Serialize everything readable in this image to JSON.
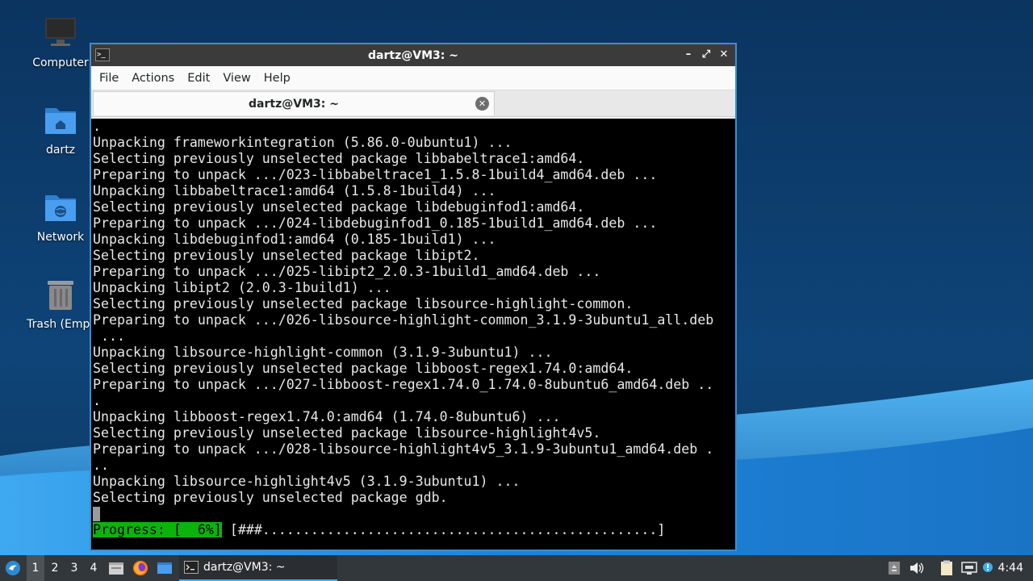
{
  "desktop": {
    "icons": [
      {
        "label": "Computer",
        "icon": "computer-icon"
      },
      {
        "label": "dartz",
        "icon": "home-folder-icon"
      },
      {
        "label": "Network",
        "icon": "network-folder-icon"
      },
      {
        "label": "Trash (Empt",
        "icon": "trash-icon"
      }
    ]
  },
  "window": {
    "title": "dartz@VM3: ~",
    "app_icon_glyph": ">_",
    "controls": {
      "minimize": "–",
      "maximize": "⤢",
      "close": "✕"
    },
    "menu": [
      "File",
      "Actions",
      "Edit",
      "View",
      "Help"
    ],
    "tab": {
      "label": "dartz@VM3: ~",
      "close_glyph": "✕"
    }
  },
  "terminal": {
    "lines": [
      ".",
      "Unpacking frameworkintegration (5.86.0-0ubuntu1) ...",
      "Selecting previously unselected package libbabeltrace1:amd64.",
      "Preparing to unpack .../023-libbabeltrace1_1.5.8-1build4_amd64.deb ...",
      "Unpacking libbabeltrace1:amd64 (1.5.8-1build4) ...",
      "Selecting previously unselected package libdebuginfod1:amd64.",
      "Preparing to unpack .../024-libdebuginfod1_0.185-1build1_amd64.deb ...",
      "Unpacking libdebuginfod1:amd64 (0.185-1build1) ...",
      "Selecting previously unselected package libipt2.",
      "Preparing to unpack .../025-libipt2_2.0.3-1build1_amd64.deb ...",
      "Unpacking libipt2 (2.0.3-1build1) ...",
      "Selecting previously unselected package libsource-highlight-common.",
      "Preparing to unpack .../026-libsource-highlight-common_3.1.9-3ubuntu1_all.deb",
      " ...",
      "Unpacking libsource-highlight-common (3.1.9-3ubuntu1) ...",
      "Selecting previously unselected package libboost-regex1.74.0:amd64.",
      "Preparing to unpack .../027-libboost-regex1.74.0_1.74.0-8ubuntu6_amd64.deb ..",
      ".",
      "Unpacking libboost-regex1.74.0:amd64 (1.74.0-8ubuntu6) ...",
      "Selecting previously unselected package libsource-highlight4v5.",
      "Preparing to unpack .../028-libsource-highlight4v5_3.1.9-3ubuntu1_amd64.deb .",
      "..",
      "Unpacking libsource-highlight4v5 (3.1.9-3ubuntu1) ...",
      "Selecting previously unselected package gdb."
    ],
    "progress_label": "Progress: [  6%]",
    "progress_bar": " [###.................................................]",
    "progress_fraction": 0.06
  },
  "taskbar": {
    "workspaces": [
      "1",
      "2",
      "3",
      "4"
    ],
    "active_workspace": "1",
    "quicklaunch": [
      "file-manager-icon",
      "firefox-icon",
      "show-desktop-icon"
    ],
    "task": {
      "label": "dartz@VM3: ~",
      "icon": "terminal-icon"
    },
    "tray": [
      "removable-media-icon",
      "volume-icon",
      "clipboard-icon",
      "network-icon",
      "update-notifier-icon"
    ],
    "clock": "4:44"
  },
  "colors": {
    "window_border": "#3c8fd0",
    "progress_green": "#0cb30c",
    "taskbar": "#32373c"
  }
}
